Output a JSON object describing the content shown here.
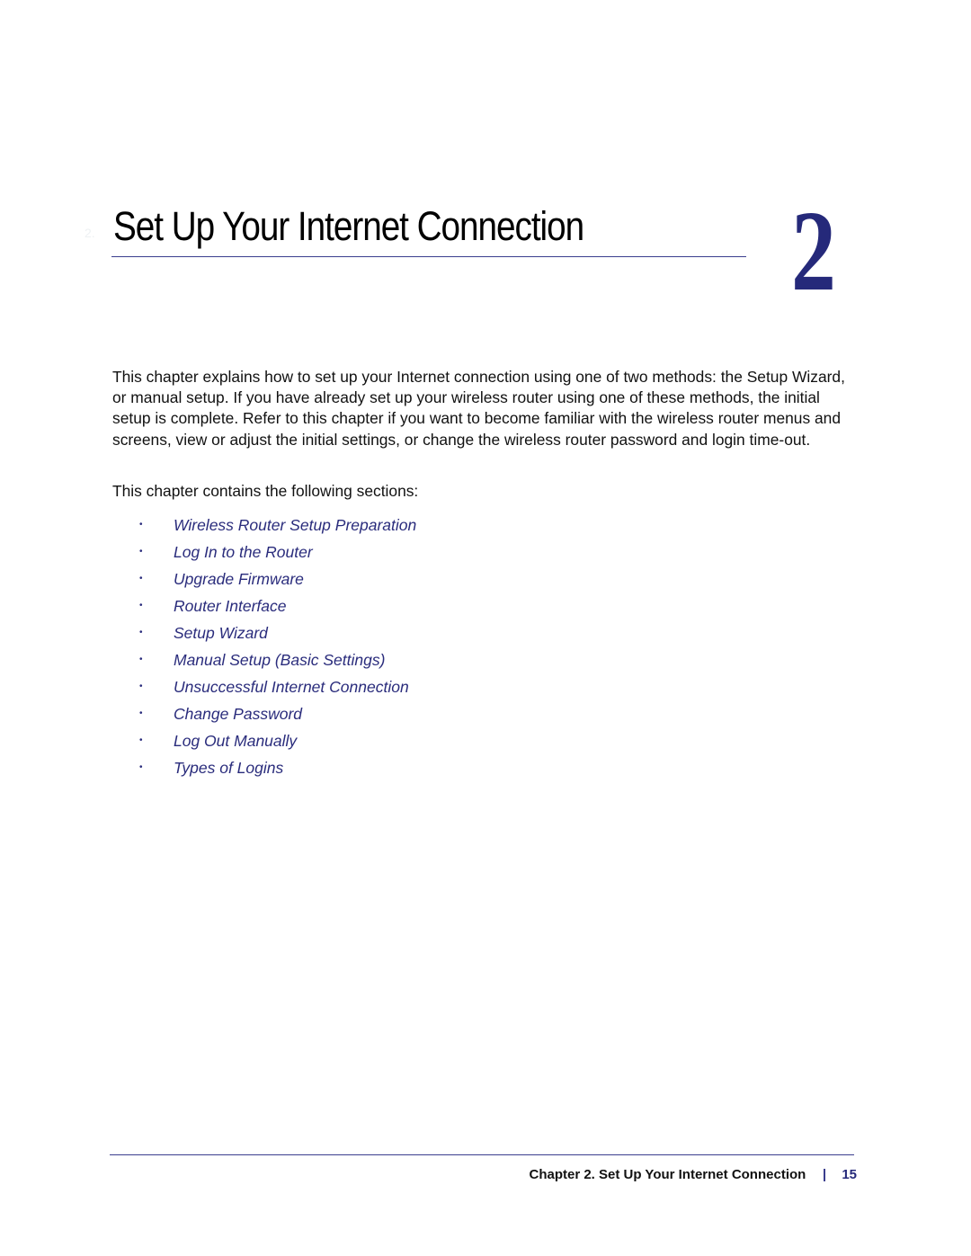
{
  "header": {
    "ghost_number": "2.",
    "title": "Set Up Your Internet Connection",
    "chapter_number": "2"
  },
  "body": {
    "paragraph": "This chapter explains how to set up your Internet connection using one of two methods: the Setup Wizard, or manual setup. If you have already set up your wireless router using one of these methods, the initial setup is complete. Refer to this chapter if you want to become familiar with the wireless router menus and screens, view or adjust the initial settings, or change the wireless router password and login time-out.",
    "intro": "This chapter contains the following sections:",
    "bullet_glyph": "•",
    "sections": [
      {
        "label": "Wireless Router Setup Preparation"
      },
      {
        "label": "Log In to the Router"
      },
      {
        "label": "Upgrade Firmware"
      },
      {
        "label": "Router Interface"
      },
      {
        "label": "Setup Wizard"
      },
      {
        "label": "Manual Setup (Basic Settings)"
      },
      {
        "label": "Unsuccessful Internet Connection"
      },
      {
        "label": "Change Password"
      },
      {
        "label": "Log Out Manually"
      },
      {
        "label": "Types of Logins"
      }
    ]
  },
  "footer": {
    "chapter_label": "Chapter 2.  Set Up Your Internet Connection",
    "page_number": "15"
  },
  "colors": {
    "accent_navy": "#25297a",
    "link_blue": "#2a2c7c",
    "rule": "#3b3e8e",
    "text": "#111111"
  }
}
